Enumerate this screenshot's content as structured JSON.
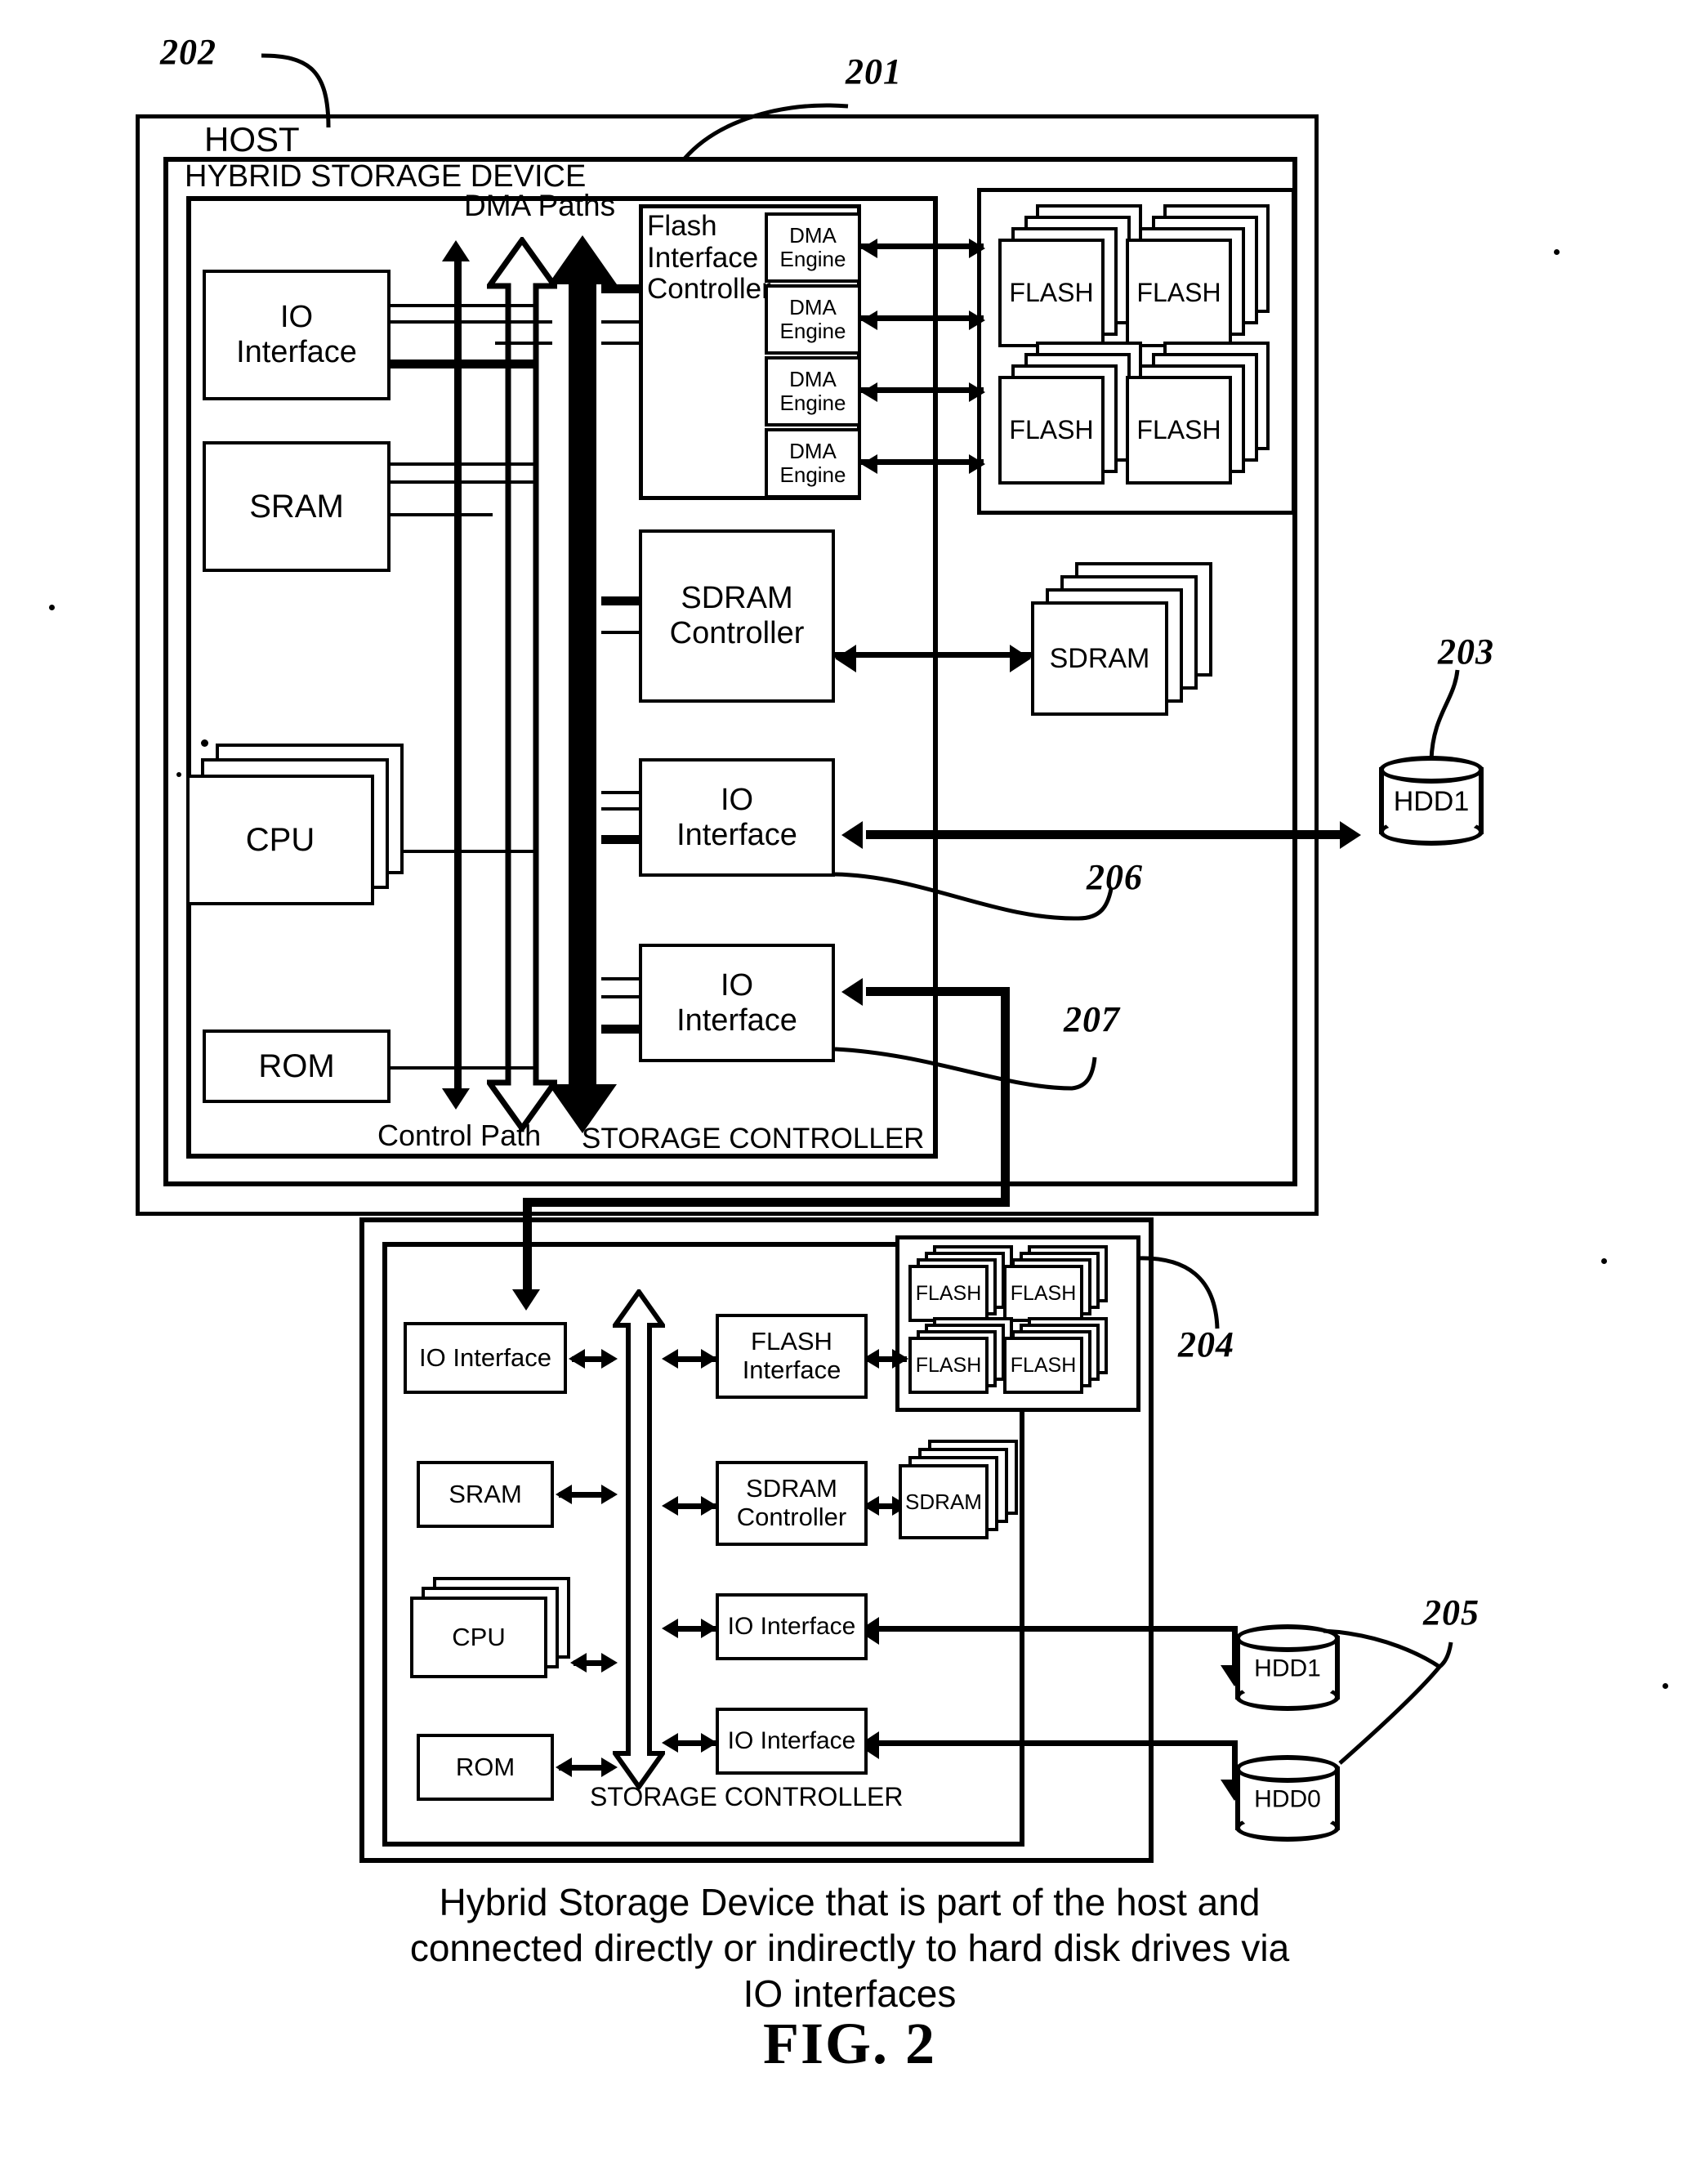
{
  "figure": {
    "number": "FIG. 2",
    "caption_line1": "Hybrid Storage Device that is part of the host and",
    "caption_line2": "connected directly or indirectly to hard disk drives via",
    "caption_line3": "IO interfaces"
  },
  "reference_numerals": {
    "host": "202",
    "hybrid_storage_device": "201",
    "hdd_top": "203",
    "flash_array_bottom": "204",
    "hdd_group_bottom": "205",
    "io_interface_206": "206",
    "io_interface_207": "207"
  },
  "top_section": {
    "host_label": "HOST",
    "device_label": "HYBRID STORAGE DEVICE",
    "controller_label": "STORAGE CONTROLLER",
    "dma_paths_label": "DMA Paths",
    "control_path_label": "Control Path",
    "blocks": {
      "io_interface_host": "IO\nInterface",
      "sram": "SRAM",
      "cpu": "CPU",
      "rom": "ROM",
      "flash_interface_controller": "Flash\nInterface\nController",
      "dma_engine": "DMA\nEngine",
      "sdram_controller": "SDRAM\nController",
      "io_interface_hdd": "IO\nInterface",
      "io_interface_sub": "IO\nInterface"
    },
    "dma_engines": [
      "DMA\nEngine",
      "DMA\nEngine",
      "DMA\nEngine",
      "DMA\nEngine"
    ],
    "flash_chips": [
      "FLASH",
      "FLASH",
      "FLASH",
      "FLASH"
    ],
    "sdram_chip": "SDRAM",
    "hdd": "HDD1"
  },
  "bottom_section": {
    "controller_label": "STORAGE CONTROLLER",
    "blocks": {
      "io_interface_in": "IO Interface",
      "sram": "SRAM",
      "cpu": "CPU",
      "rom": "ROM",
      "flash_interface": "FLASH\nInterface",
      "sdram_controller": "SDRAM\nController",
      "io_interface_hdd1": "IO Interface",
      "io_interface_hdd0": "IO Interface"
    },
    "flash_chips": [
      "FLASH",
      "FLASH",
      "FLASH",
      "FLASH"
    ],
    "sdram_chip": "SDRAM",
    "hdds": [
      "HDD1",
      "HDD0"
    ]
  },
  "colors": {
    "ink": "#000000",
    "paper": "#ffffff"
  }
}
